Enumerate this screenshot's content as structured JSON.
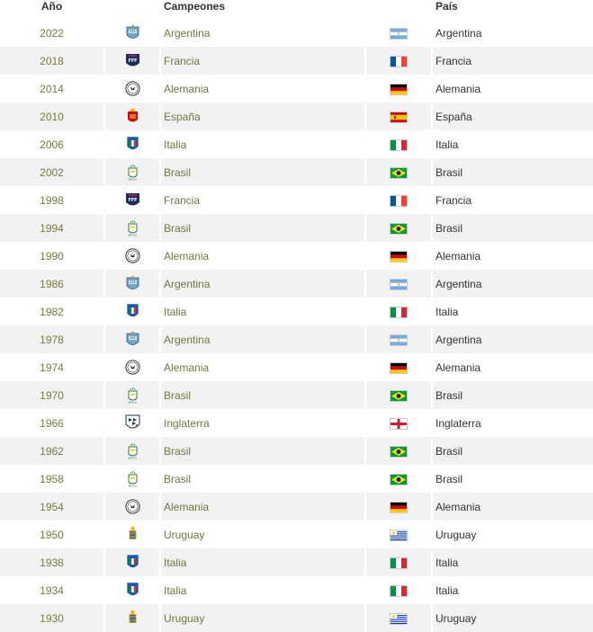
{
  "headers": {
    "year": "Año",
    "champions": "Campeones",
    "country": "País"
  },
  "colors": {
    "team_text": "#6b7a3a",
    "year_text": "#7a7a3a",
    "row_alt": "#f2f2f2"
  },
  "rows": [
    {
      "year": "2022",
      "team": "Argentina",
      "country": "Argentina",
      "crest": "argentina-crest-icon",
      "flag": "argentina"
    },
    {
      "year": "2018",
      "team": "Francia",
      "country": "Francia",
      "crest": "france-crest-icon",
      "flag": "france"
    },
    {
      "year": "2014",
      "team": "Alemania",
      "country": "Alemania",
      "crest": "germany-crest-icon",
      "flag": "germany"
    },
    {
      "year": "2010",
      "team": "España",
      "country": "España",
      "crest": "spain-crest-icon",
      "flag": "spain"
    },
    {
      "year": "2006",
      "team": "Italia",
      "country": "Italia",
      "crest": "italy-crest-icon",
      "flag": "italy"
    },
    {
      "year": "2002",
      "team": "Brasil",
      "country": "Brasil",
      "crest": "brazil-crest-icon",
      "flag": "brazil"
    },
    {
      "year": "1998",
      "team": "Francia",
      "country": "Francia",
      "crest": "france-crest-icon",
      "flag": "france"
    },
    {
      "year": "1994",
      "team": "Brasil",
      "country": "Brasil",
      "crest": "brazil-crest-icon",
      "flag": "brazil"
    },
    {
      "year": "1990",
      "team": "Alemania",
      "country": "Alemania",
      "crest": "germany-crest-icon",
      "flag": "germany"
    },
    {
      "year": "1986",
      "team": "Argentina",
      "country": "Argentina",
      "crest": "argentina-crest-icon",
      "flag": "argentina"
    },
    {
      "year": "1982",
      "team": "Italia",
      "country": "Italia",
      "crest": "italy-crest-icon",
      "flag": "italy"
    },
    {
      "year": "1978",
      "team": "Argentina",
      "country": "Argentina",
      "crest": "argentina-crest-icon",
      "flag": "argentina"
    },
    {
      "year": "1974",
      "team": "Alemania",
      "country": "Alemania",
      "crest": "germany-crest-icon",
      "flag": "germany"
    },
    {
      "year": "1970",
      "team": "Brasil",
      "country": "Brasil",
      "crest": "brazil-crest-icon",
      "flag": "brazil"
    },
    {
      "year": "1966",
      "team": "Inglaterra",
      "country": "Inglaterra",
      "crest": "england-crest-icon",
      "flag": "england"
    },
    {
      "year": "1962",
      "team": "Brasil",
      "country": "Brasil",
      "crest": "brazil-crest-icon",
      "flag": "brazil"
    },
    {
      "year": "1958",
      "team": "Brasil",
      "country": "Brasil",
      "crest": "brazil-crest-icon",
      "flag": "brazil"
    },
    {
      "year": "1954",
      "team": "Alemania",
      "country": "Alemania",
      "crest": "germany-crest-icon",
      "flag": "germany"
    },
    {
      "year": "1950",
      "team": "Uruguay",
      "country": "Uruguay",
      "crest": "uruguay-crest-icon",
      "flag": "uruguay"
    },
    {
      "year": "1938",
      "team": "Italia",
      "country": "Italia",
      "crest": "italy-crest-icon",
      "flag": "italy"
    },
    {
      "year": "1934",
      "team": "Italia",
      "country": "Italia",
      "crest": "italy-crest-icon",
      "flag": "italy"
    },
    {
      "year": "1930",
      "team": "Uruguay",
      "country": "Uruguay",
      "crest": "uruguay-crest-icon",
      "flag": "uruguay"
    }
  ]
}
